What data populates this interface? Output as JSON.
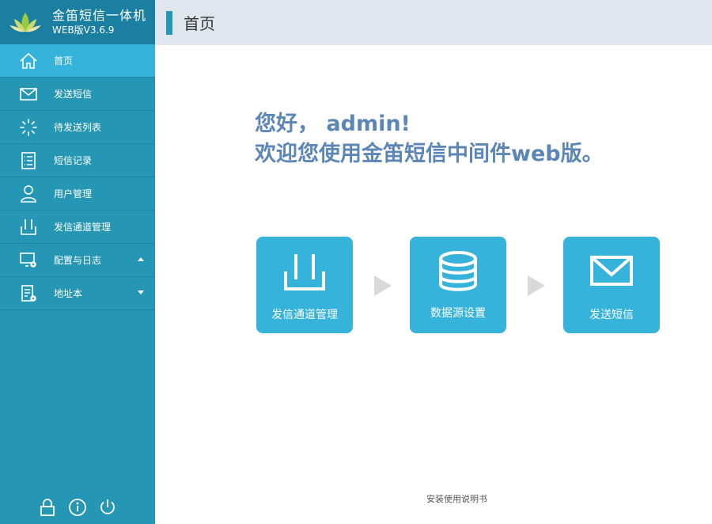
{
  "brand": {
    "title": "金笛短信一体机",
    "version": "WEB版V3.6.9"
  },
  "sidebar": {
    "items": [
      {
        "label": "首页",
        "icon": "home-icon",
        "active": true
      },
      {
        "label": "发送短信",
        "icon": "envelope-icon"
      },
      {
        "label": "待发送列表",
        "icon": "loading-spinner-icon"
      },
      {
        "label": "短信记录",
        "icon": "list-document-icon"
      },
      {
        "label": "用户管理",
        "icon": "user-icon"
      },
      {
        "label": "发信通道管理",
        "icon": "channel-device-icon"
      },
      {
        "label": "配置与日志",
        "icon": "monitor-gear-icon",
        "caret": "up"
      },
      {
        "label": "地址本",
        "icon": "address-book-gear-icon",
        "caret": "down"
      }
    ],
    "bottom_icons": [
      "lock-icon",
      "info-icon",
      "power-icon"
    ]
  },
  "header": {
    "title": "首页"
  },
  "main": {
    "greeting": "您好， admin!",
    "welcome": "欢迎您使用金笛短信中间件web版。",
    "cards": [
      {
        "label": "发信通道管理",
        "icon": "channel-device-icon"
      },
      {
        "label": "数据源设置",
        "icon": "database-icon"
      },
      {
        "label": "发送短信",
        "icon": "envelope-icon"
      }
    ],
    "manual_link": "安装使用说明书"
  },
  "colors": {
    "sidebar": "#2596b4",
    "sidebar_active": "#35b3db",
    "brand_bar": "#1a7fa0",
    "header_bg": "#dfe6ed",
    "welcome_text": "#5b86b6",
    "card": "#35b3db",
    "arrow": "#d9d9d9"
  }
}
